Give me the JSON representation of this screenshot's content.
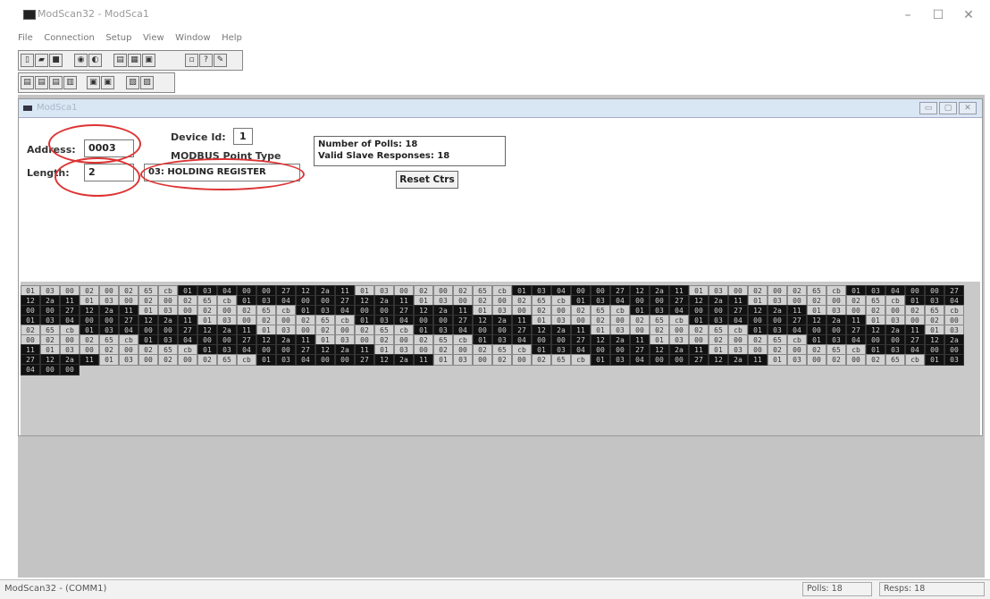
{
  "window": {
    "title": "ModScan32 - ModSca1",
    "minimize": "–",
    "maximize": "☐",
    "close": "✕"
  },
  "menu": [
    "File",
    "Connection",
    "Setup",
    "View",
    "Window",
    "Help"
  ],
  "toolbar1": [
    "new-icon",
    "open-icon",
    "save-icon",
    "connect-icon",
    "disconnect-icon",
    "display-icon",
    "print-icon",
    "monitor-icon",
    "info-icon",
    "help-icon",
    "context-help-icon"
  ],
  "toolbar2": [
    "display-binary-icon",
    "display-decimal-icon",
    "display-hex-icon",
    "display-float-icon",
    "view-traffic-icon",
    "view-log-icon",
    "tile-icon",
    "cascade-icon"
  ],
  "child": {
    "title": "ModSca1",
    "address_label": "Address:",
    "address_value": "0003",
    "length_label": "Length:",
    "length_value": "2",
    "device_id_label": "Device Id:",
    "device_id_value": "1",
    "point_type_label": "MODBUS Point Type",
    "point_type_value": "03: HOLDING REGISTER",
    "polls_text": "Number of Polls: 18",
    "responses_text": "Valid Slave Responses: 18",
    "reset_label": "Reset Ctrs"
  },
  "traffic": {
    "frame_tx": [
      "01",
      "03",
      "00",
      "02",
      "00",
      "02",
      "65",
      "cb"
    ],
    "frame_rx": [
      "01",
      "03",
      "04",
      "00",
      "00",
      "27",
      "12",
      "2a",
      "11"
    ]
  },
  "status": {
    "left": "ModScan32 - (COMM1)",
    "polls": "Polls: 18",
    "resps": "Resps: 18"
  }
}
